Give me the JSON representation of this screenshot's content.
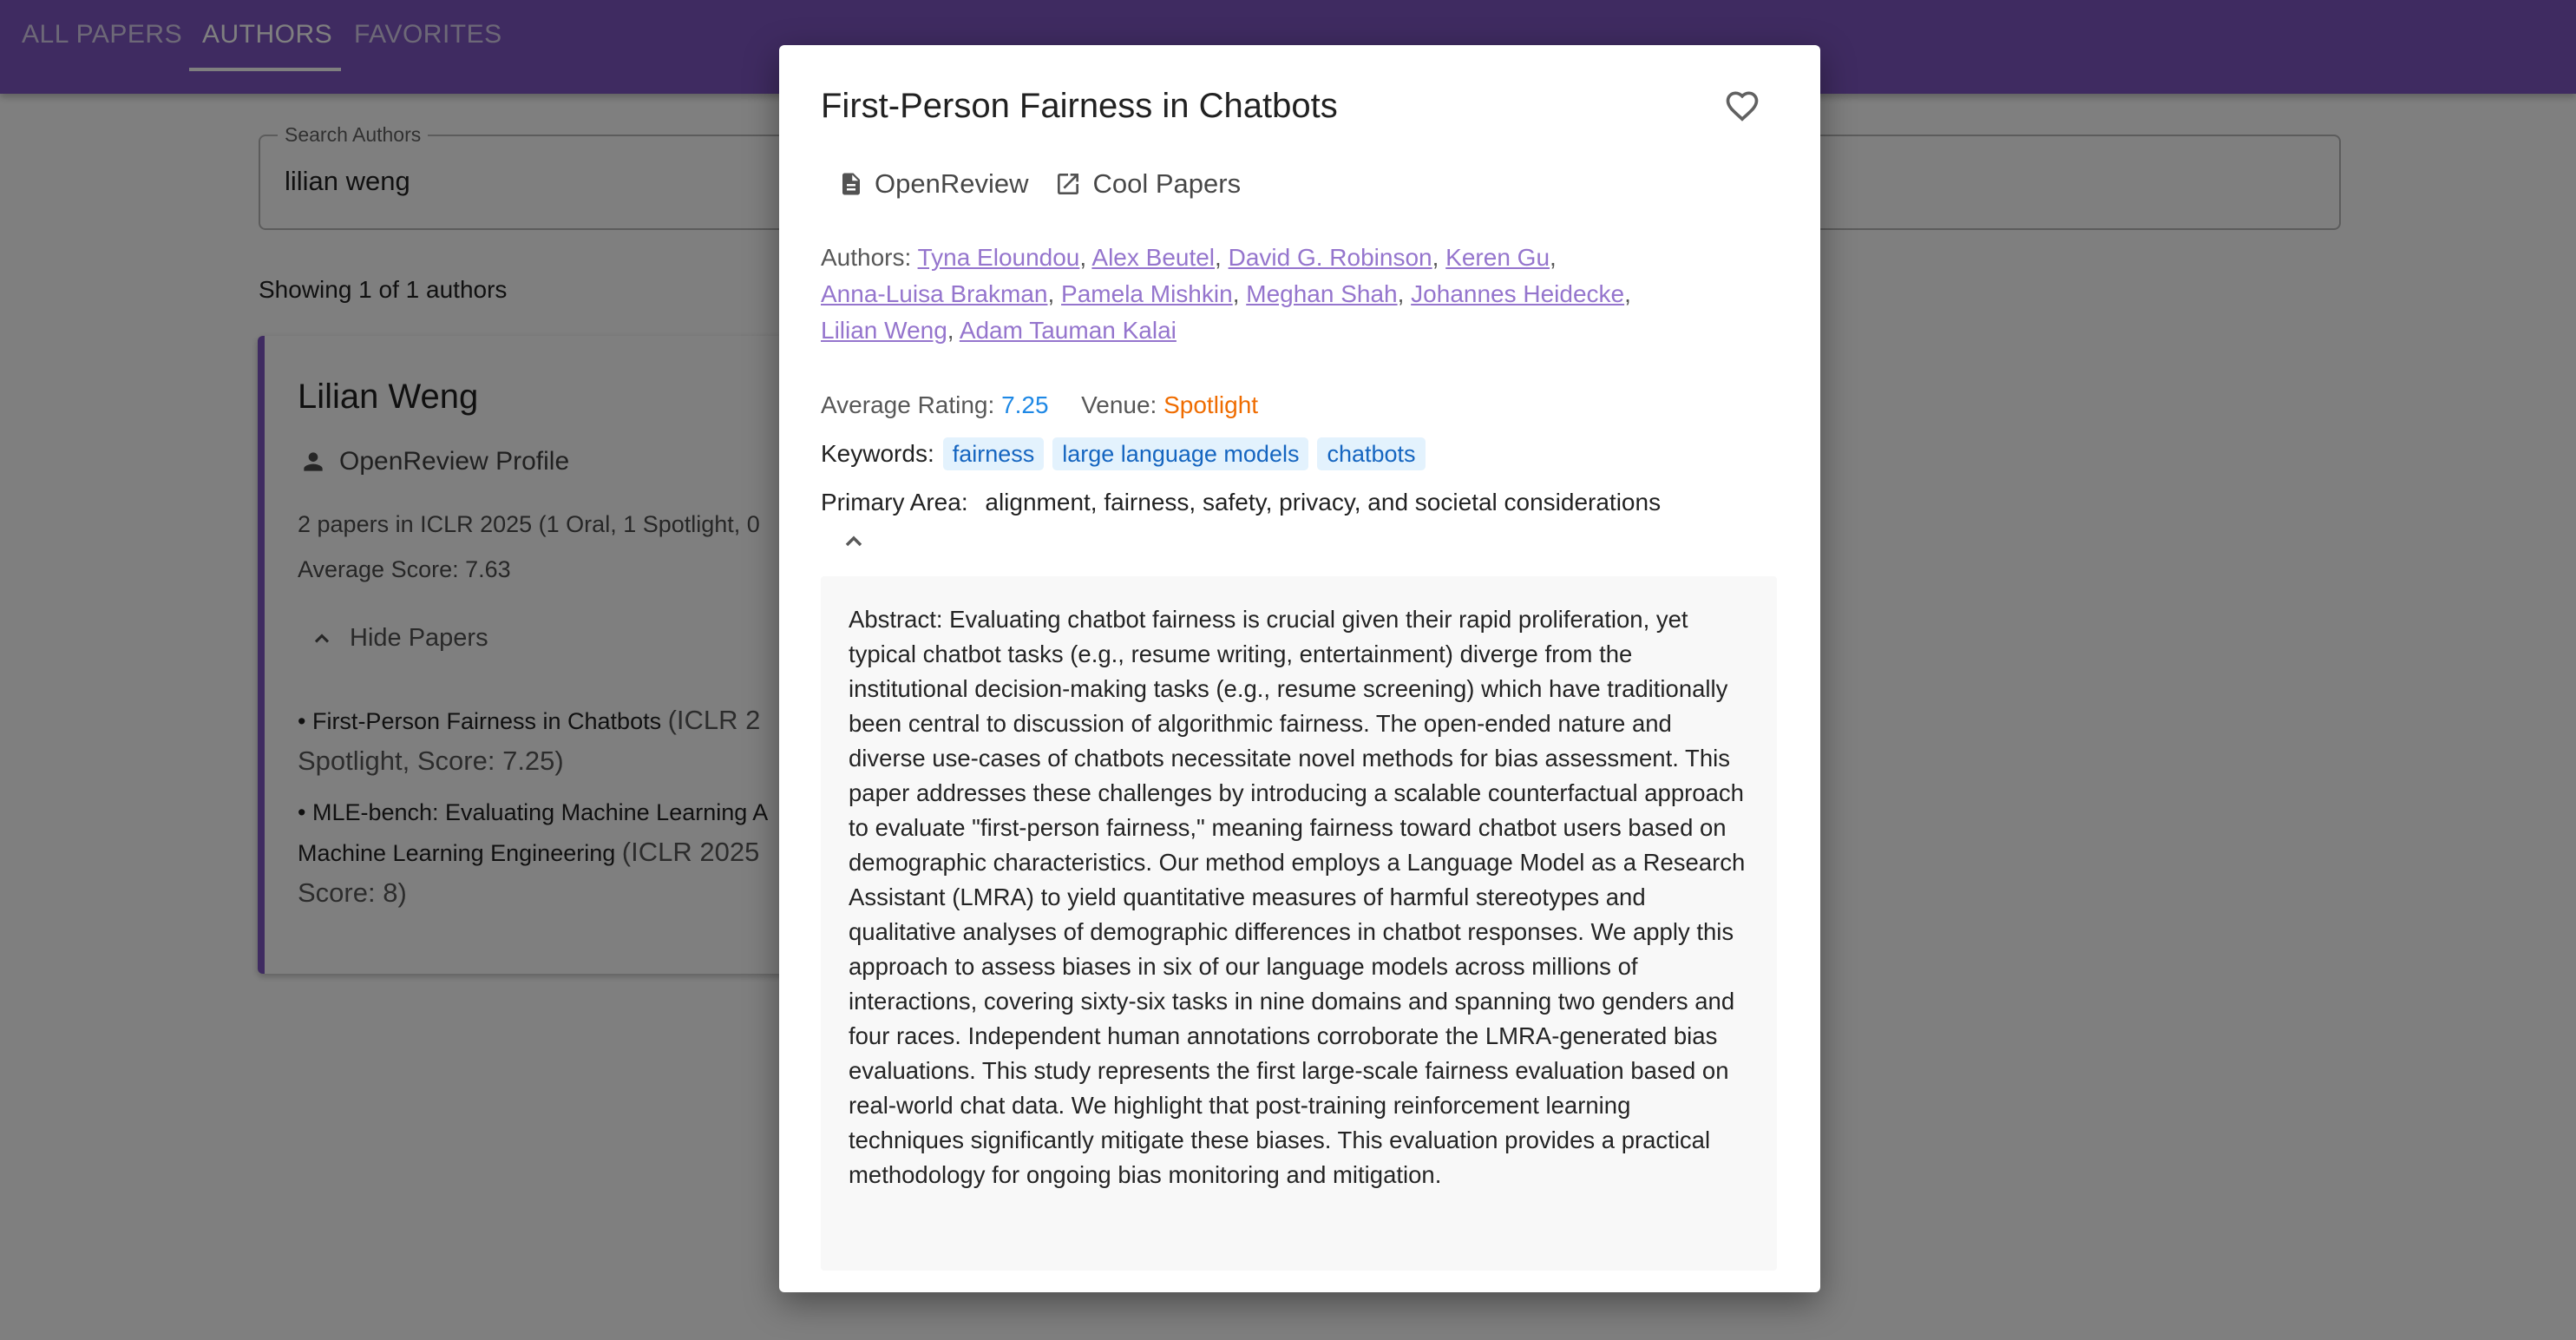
{
  "nav": {
    "tabs": [
      "ALL PAPERS",
      "AUTHORS",
      "FAVORITES"
    ],
    "active_tab": "AUTHORS"
  },
  "search": {
    "label": "Search Authors",
    "value": "lilian weng"
  },
  "results": {
    "summary": "Showing 1 of 1 authors"
  },
  "author_card": {
    "name": "Lilian Weng",
    "profile_link": "OpenReview Profile",
    "papers_summary": "2 papers in ICLR 2025 (1 Oral, 1 Spotlight, 0",
    "average_score": "Average Score: 7.63",
    "toggle_label": "Hide Papers",
    "papers": [
      {
        "title": "• First-Person Fairness in Chatbots",
        "meta_line1": "(ICLR 2",
        "meta_line2": "Spotlight, Score: 7.25)"
      },
      {
        "title": "• MLE-bench: Evaluating Machine Learning A",
        "title_line2": "Machine Learning Engineering",
        "meta_line1": "(ICLR 2025",
        "meta_line2": "Score: 8)"
      }
    ]
  },
  "modal": {
    "title": "First-Person Fairness in Chatbots",
    "links": {
      "openreview": "OpenReview",
      "cool_papers": "Cool Papers"
    },
    "authors_label": "Authors:",
    "authors": [
      "Tyna Eloundou",
      "Alex Beutel",
      "David G. Robinson",
      "Keren Gu",
      "Anna-Luisa Brakman",
      "Pamela Mishkin",
      "Meghan Shah",
      "Johannes Heidecke",
      "Lilian Weng",
      "Adam Tauman Kalai"
    ],
    "rating_label": "Average Rating:",
    "rating_value": "7.25",
    "venue_label": "Venue:",
    "venue_value": "Spotlight",
    "keywords_label": "Keywords:",
    "keywords": [
      "fairness",
      "large language models",
      "chatbots"
    ],
    "primary_area_label": "Primary Area:",
    "primary_area_value": "alignment, fairness, safety, privacy, and societal considerations",
    "abstract": "Abstract: Evaluating chatbot fairness is crucial given their rapid proliferation, yet typical chatbot tasks (e.g., resume writing, entertainment) diverge from the institutional decision-making tasks (e.g., resume screening) which have traditionally been central to discussion of algorithmic fairness. The open-ended nature and diverse use-cases of chatbots necessitate novel methods for bias assessment. This paper addresses these challenges by introducing a scalable counterfactual approach to evaluate \"first-person fairness,\" meaning fairness toward chatbot users based on demographic characteristics. Our method employs a Language Model as a Research Assistant (LMRA) to yield quantitative measures of harmful stereotypes and qualitative analyses of demographic differences in chatbot responses. We apply this approach to assess biases in six of our language models across millions of interactions, covering sixty-six tasks in nine domains and spanning two genders and four races. Independent human annotations corroborate the LMRA-generated bias evaluations. This study represents the first large-scale fairness evaluation based on real-world chat data. We highlight that post-training reinforcement learning techniques significantly mitigate these biases. This evaluation provides a practical methodology for ongoing bias monitoring and mitigation."
  },
  "colors": {
    "primary": "#7e57c2",
    "author_link": "#9575cd",
    "rating": "#1e88e5",
    "venue": "#ef6c00",
    "chip_bg": "#e3f2fd",
    "chip_text": "#1565c0"
  }
}
